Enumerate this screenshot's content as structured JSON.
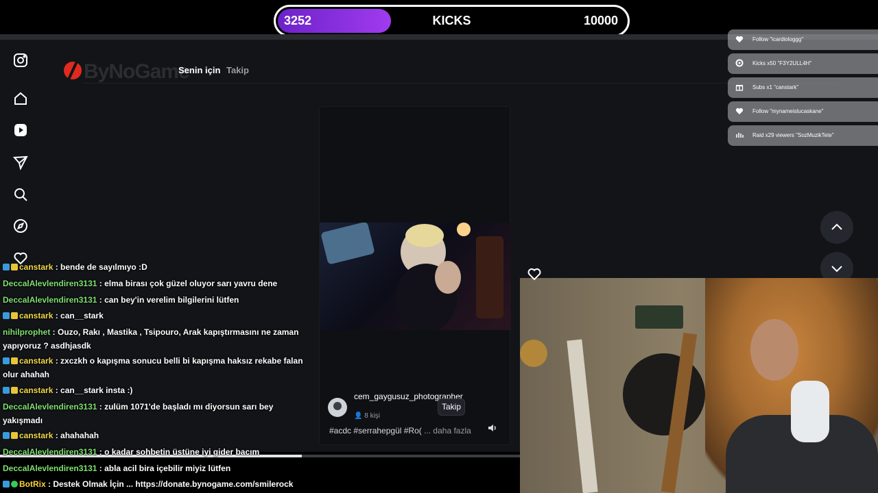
{
  "kicks": {
    "current": "3252",
    "label": "KICKS",
    "goal": "10000",
    "progress": 0.3252
  },
  "header": {
    "logo": "ByNoGame",
    "tabs": [
      "Senin için",
      "Takip"
    ]
  },
  "rail": [
    "instagram-icon",
    "home-icon",
    "play-icon",
    "send-icon",
    "search-icon",
    "compass-icon",
    "heart-icon"
  ],
  "video": {
    "creator_name": "cem_gaygusuz_photographer",
    "followers": "8 kişi",
    "follow_label": "Takip",
    "caption": "#acdc #serrahepgül #Ro(",
    "more": "... daha fazla"
  },
  "alerts": [
    {
      "icon": "heart-icon",
      "text": "Follow \"icardiologgg\""
    },
    {
      "icon": "kick-icon",
      "text": "Kicks x50 \"F3Y2ULL4H\""
    },
    {
      "icon": "gift-icon",
      "text": "Subs x1 \"canstark\""
    },
    {
      "icon": "heart-icon",
      "text": "Follow \"mynameislucaskane\""
    },
    {
      "icon": "raid-icon",
      "text": "Raid x29 viewers \"SozMuzikTete\""
    }
  ],
  "chat": [
    {
      "user": "canstark",
      "msg": ": bende de sayılmıyo :D",
      "badges": [
        "mod",
        "sub"
      ],
      "color": "yellow"
    },
    {
      "user": "DeccalAlevlendiren3131",
      "msg": ": elma birası çok güzel oluyor sarı yavru dene",
      "badges": [],
      "color": "green"
    },
    {
      "user": "DeccalAlevlendiren3131",
      "msg": ": can bey'in verelim bilgilerini lütfen",
      "badges": [],
      "color": "green"
    },
    {
      "user": "canstark",
      "msg": ": can__stark",
      "badges": [
        "mod",
        "sub"
      ],
      "color": "yellow"
    },
    {
      "user": "nihilprophet",
      "msg": ": Ouzo, Rakı , Mastika , Tsipouro, Arak kapıştırmasını ne zaman yapıyoruz ? asdhjasdk",
      "badges": [],
      "color": "green"
    },
    {
      "user": "canstark",
      "msg": ": zxczkh o kapışma sonucu belli bi kapışma haksız rekabe falan olur ahahah",
      "badges": [
        "mod",
        "sub"
      ],
      "color": "yellow"
    },
    {
      "user": "canstark",
      "msg": ": can__stark insta :)",
      "badges": [
        "mod",
        "sub"
      ],
      "color": "yellow"
    },
    {
      "user": "DeccalAlevlendiren3131",
      "msg": ": zulüm 1071'de başladı mı diyorsun sarı bey yakışmadı",
      "badges": [],
      "color": "green"
    },
    {
      "user": "canstark",
      "msg": ": ahahahah",
      "badges": [
        "mod",
        "sub"
      ],
      "color": "yellow"
    },
    {
      "user": "DeccalAlevlendiren3131",
      "msg": ": o kadar sohbetin üstüne iyi gider bacım",
      "badges": [],
      "color": "green"
    },
    {
      "user": "DeccalAlevlendiren3131",
      "msg": ": abla acil bira içebilir miyiz lütfen",
      "badges": [],
      "color": "green"
    },
    {
      "user": "BotRix",
      "msg": ": Destek Olmak İçin ... https://donate.bynogame.com/smilerock",
      "badges": [
        "mod",
        "verified"
      ],
      "color": "gold"
    }
  ],
  "colors": {
    "kicks_fill": "#8a2fe0",
    "user_green": "#7fe06f",
    "user_yellow": "#f2d94b"
  }
}
